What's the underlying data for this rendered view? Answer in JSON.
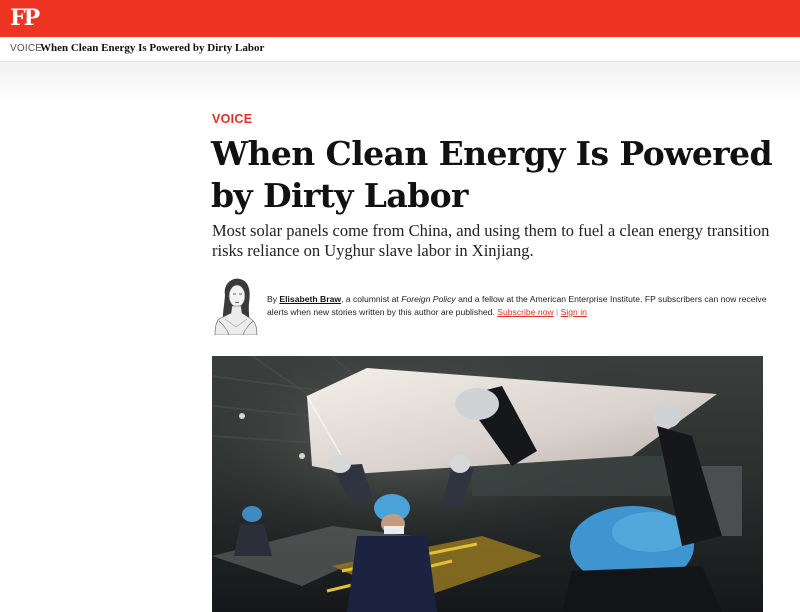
{
  "header": {
    "logo": "FP",
    "section": "VOICE",
    "title": "When Clean Energy Is Powered by Dirty Labor"
  },
  "article": {
    "section_label": "VOICE",
    "headline": "When Clean Energy Is Powered by Dirty Labor",
    "dek": "Most solar panels come from China, and using them to fuel a clean energy transition risks reliance on Uyghur slave labor in Xinjiang.",
    "byline": {
      "by": "By",
      "author": "Elisabeth Braw",
      "text1": ", a columnist at",
      "publication": "Foreign Policy",
      "text2": "and a fellow at the American Enterprise Institute. FP subscribers can now receive alerts when new stories written by this author are published.",
      "subscribe": "Subscribe now",
      "separator": "|",
      "signin": "Sign in"
    }
  },
  "colors": {
    "brand_red": "#ee3524",
    "section_red": "#e03127"
  },
  "icons": {
    "logo": "fp-logo",
    "avatar": "author-portrait"
  }
}
